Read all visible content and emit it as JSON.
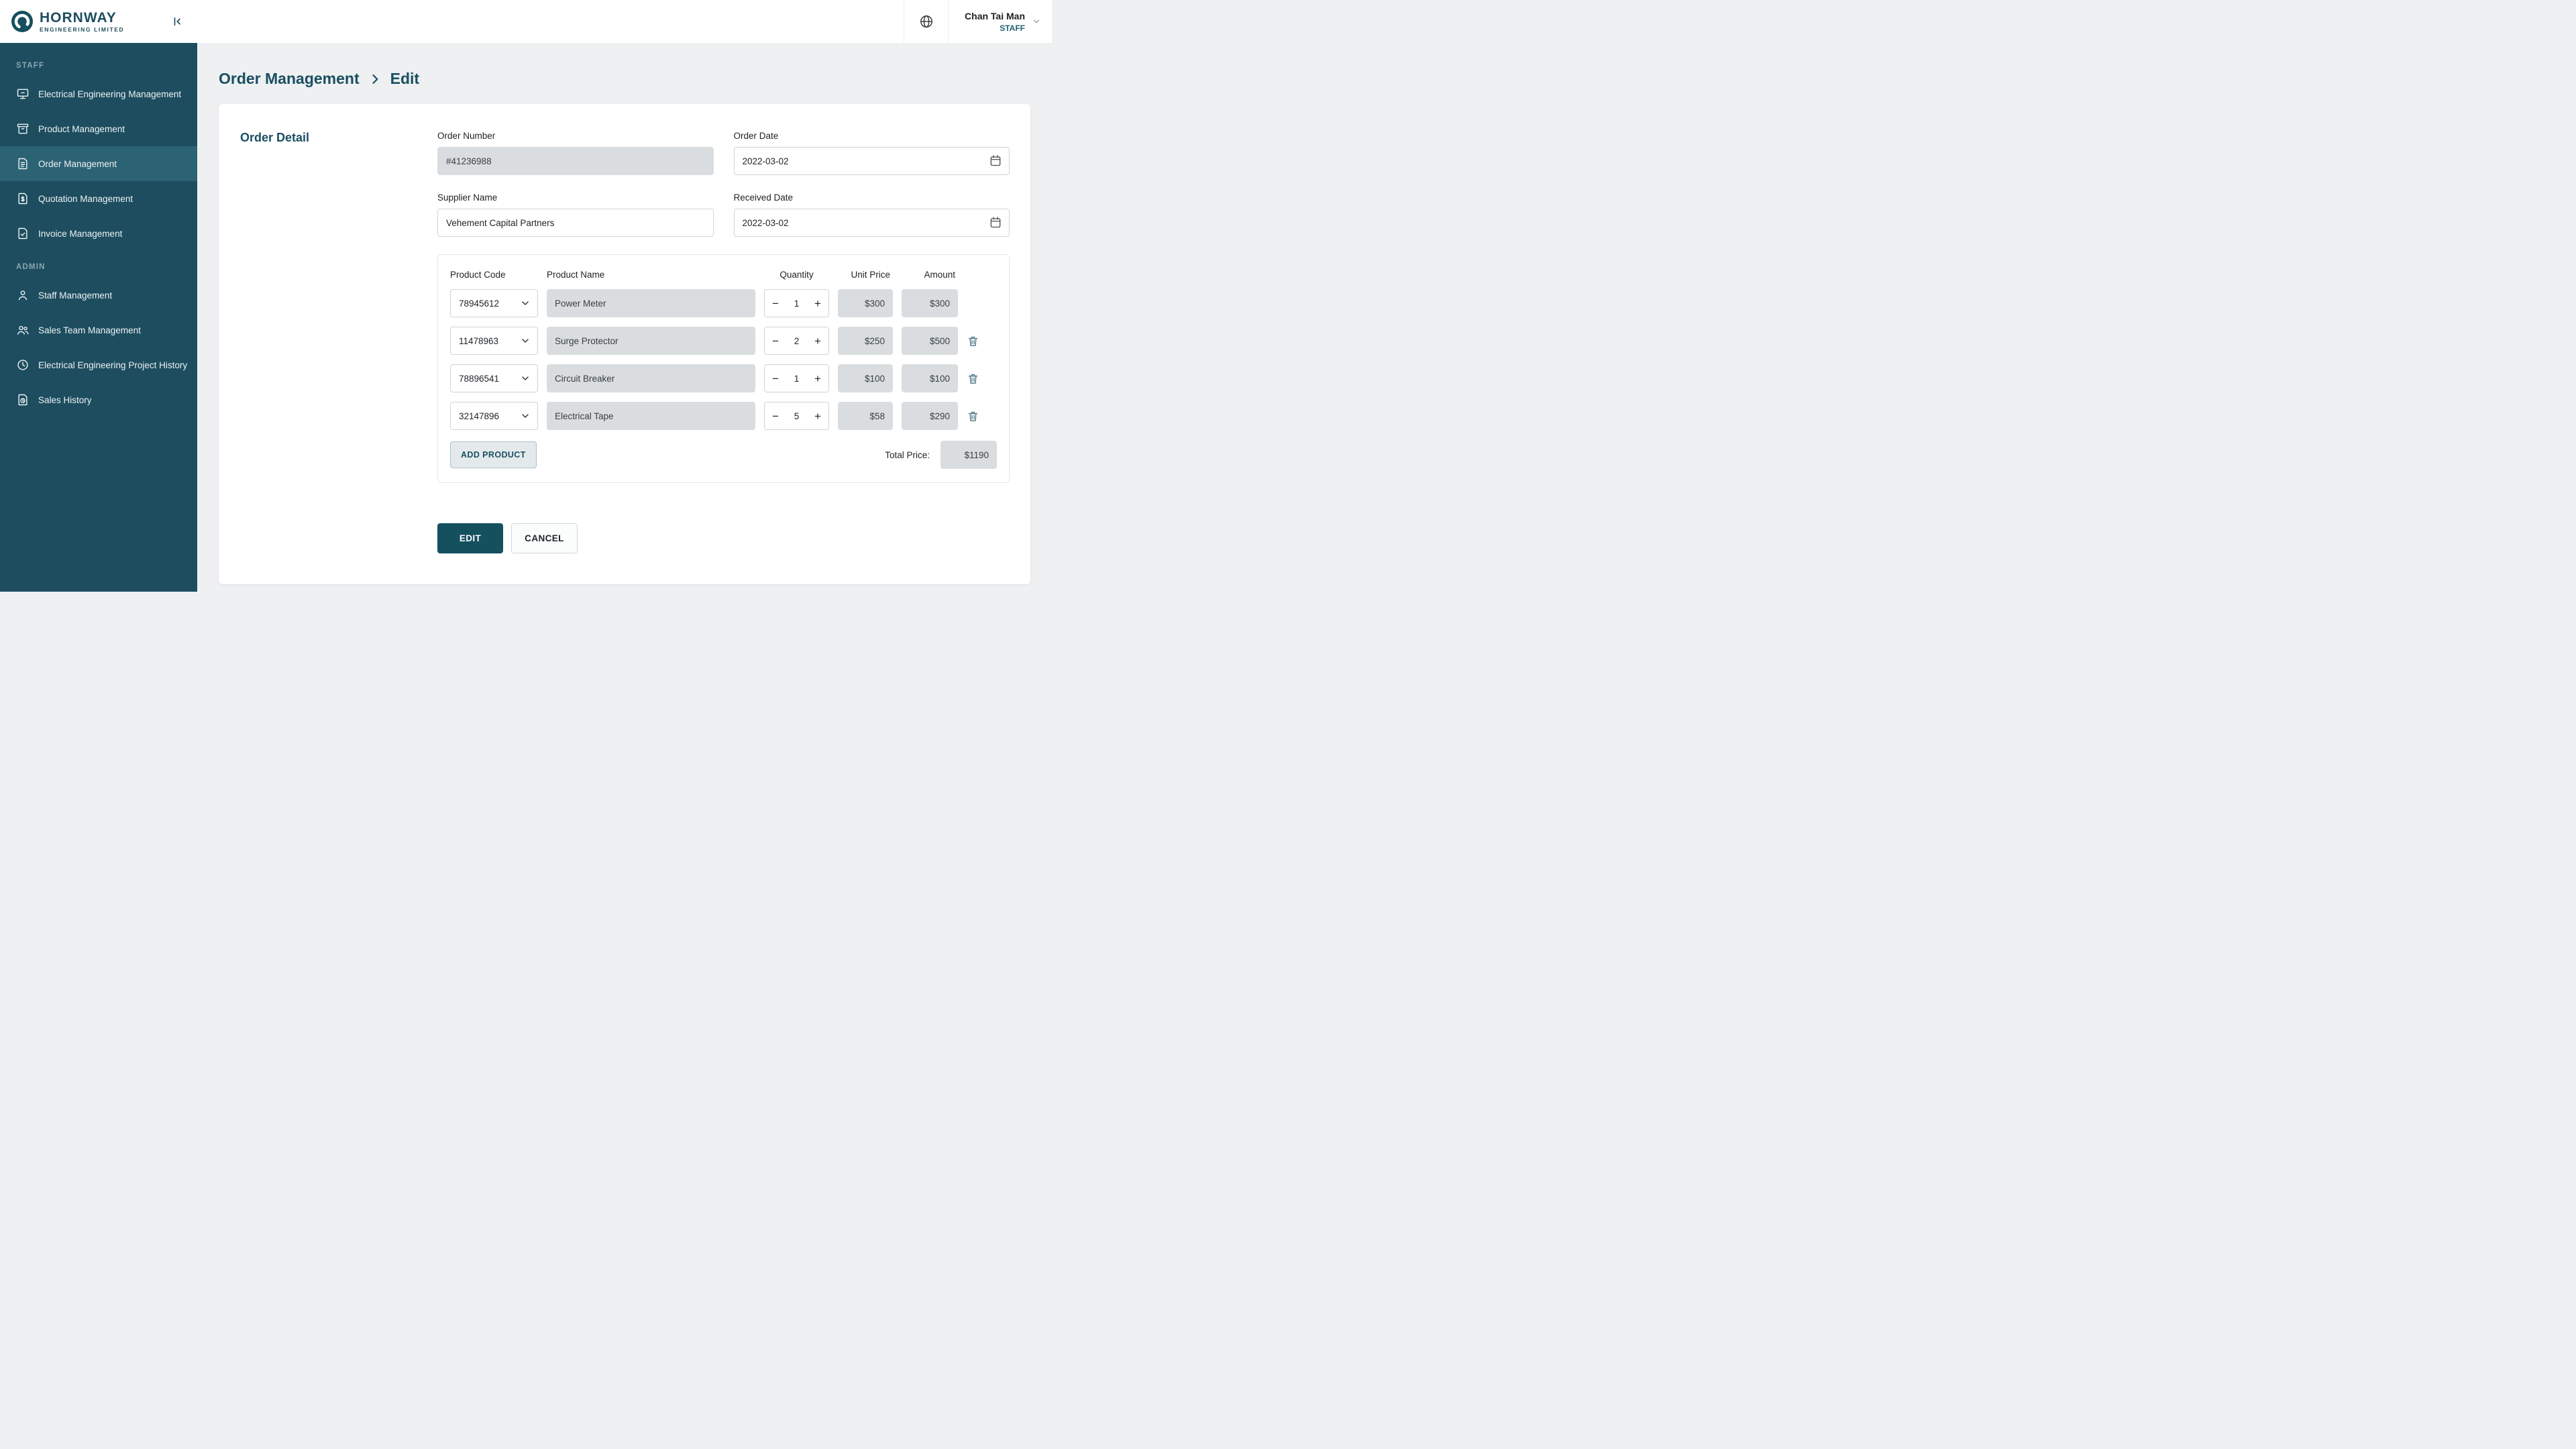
{
  "brand": {
    "name": "HORNWAY",
    "subtitle": "ENGINEERING  LIMITED"
  },
  "topbar": {
    "user_name": "Chan Tai Man",
    "user_role": "STAFF"
  },
  "sidebar": {
    "staff_section": "STAFF",
    "admin_section": "ADMIN",
    "items": [
      {
        "label": "Electrical Engineering Management"
      },
      {
        "label": "Product Management"
      },
      {
        "label": "Order Management"
      },
      {
        "label": "Quotation Management"
      },
      {
        "label": "Invoice Management"
      },
      {
        "label": "Staff Management"
      },
      {
        "label": "Sales Team Management"
      },
      {
        "label": "Electrical Engineering Project History"
      },
      {
        "label": "Sales History"
      }
    ]
  },
  "breadcrumb": {
    "parent": "Order Management",
    "current": "Edit"
  },
  "order": {
    "section_title": "Order Detail",
    "order_number": {
      "label": "Order Number",
      "value": "#41236988"
    },
    "order_date": {
      "label": "Order Date",
      "value": "2022-03-02"
    },
    "supplier_name": {
      "label": "Supplier Name",
      "value": "Vehement Capital Partners"
    },
    "received_date": {
      "label": "Received Date",
      "value": "2022-03-02"
    }
  },
  "products": {
    "headers": {
      "code": "Product Code",
      "name": "Product Name",
      "quantity": "Quantity",
      "unit_price": "Unit Price",
      "amount": "Amount"
    },
    "stepper": {
      "minus": "−",
      "plus": "+"
    },
    "rows": [
      {
        "code": "78945612",
        "name": "Power Meter",
        "quantity": "1",
        "unit_price": "$300",
        "amount": "$300"
      },
      {
        "code": "11478963",
        "name": "Surge Protector",
        "quantity": "2",
        "unit_price": "$250",
        "amount": "$500"
      },
      {
        "code": "78896541",
        "name": "Circuit Breaker",
        "quantity": "1",
        "unit_price": "$100",
        "amount": "$100"
      },
      {
        "code": "32147896",
        "name": "Electrical Tape",
        "quantity": "5",
        "unit_price": "$58",
        "amount": "$290"
      }
    ],
    "add_button": "ADD PRODUCT",
    "total_label": "Total Price:",
    "total_value": "$1190"
  },
  "actions": {
    "edit": "EDIT",
    "cancel": "CANCEL"
  },
  "colors": {
    "accent": "#15505f",
    "sidebar": "#1d4d5f",
    "sidebar_active": "#2c6374",
    "disabled_bg": "#d9dddf"
  }
}
